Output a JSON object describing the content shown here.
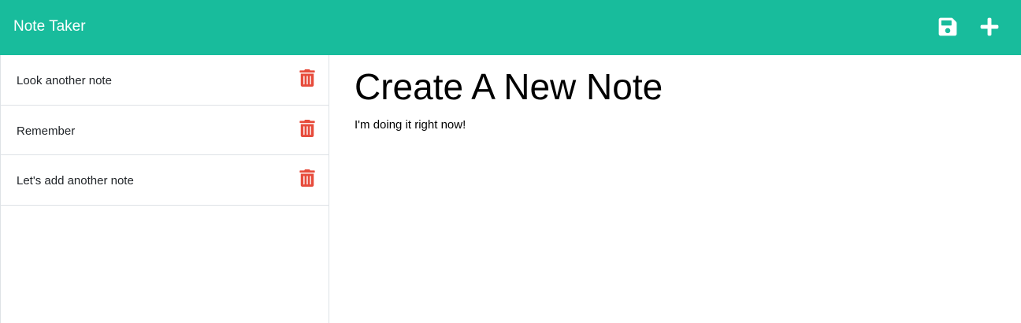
{
  "app": {
    "brand": "Note Taker",
    "accent_color": "#18bc9c",
    "icons": {
      "save": "save-icon",
      "new_note": "plus-icon",
      "delete": "trash-icon"
    }
  },
  "sidebar": {
    "notes": [
      {
        "title": "Look another note"
      },
      {
        "title": "Remember"
      },
      {
        "title": "Let's add another note"
      }
    ],
    "delete_color": "#e74c3c"
  },
  "editor": {
    "title_value": "Create A New Note",
    "text_value": "I'm doing it right now!"
  }
}
